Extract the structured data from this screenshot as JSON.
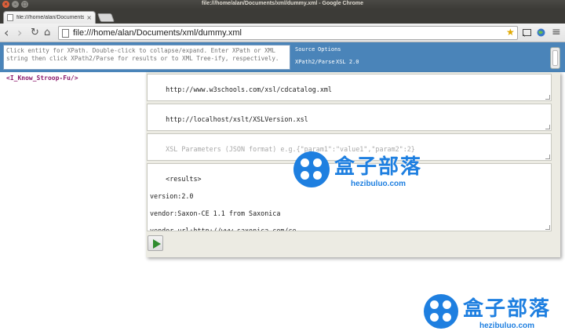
{
  "window": {
    "title": "file:///home/alan/Documents/xml/dummy.xml - Google Chrome",
    "close_glyph": "×",
    "min_glyph": "–",
    "max_glyph": "□"
  },
  "tabs": [
    {
      "label": "file:///home/alan/Documents",
      "close_glyph": "×"
    }
  ],
  "toolbar": {
    "back_glyph": "‹",
    "forward_glyph": "›",
    "reload_glyph": "↻",
    "home_glyph": "⌂",
    "url": "file:///home/alan/Documents/xml/dummy.xml",
    "star_glyph": "★",
    "menu_glyph": "≡"
  },
  "appbar": {
    "xpath_placeholder": "Click entity for XPath. Double-click to collapse/expand. Enter XPath or XML string then click XPath2/Parse for results or to XML Tree-ify, respectively.",
    "source_link": "Source",
    "options_link": "Options",
    "xpath2_link": "XPath2/Parse",
    "xsl_link": "XSL 2.0"
  },
  "tree": {
    "root": "<I_Know_Stroop-Fu/>"
  },
  "panel": {
    "xml_url": "http://www.w3schools.com/xsl/cdcatalog.xml",
    "xsl_url": "http://localhost/xslt/XSLVersion.xsl",
    "params_placeholder": "XSL Parameters (JSON format) e.g.{\"param1\":\"value1\",\"param2\":2}",
    "results": "<results>\n\nversion:2.0\n\nvendor:Saxon-CE 1.1 from Saxonica\n\nvendor url:http://www.saxonica.com/ce\n</results>"
  },
  "watermark": {
    "cn": "盒子部落",
    "en": "hezibuluo.com",
    "color": "#1e7fe0"
  },
  "colors": {
    "appbar": "#4a84b9",
    "tree_tag": "#8b1a6b",
    "run": "#2e8b2e"
  }
}
